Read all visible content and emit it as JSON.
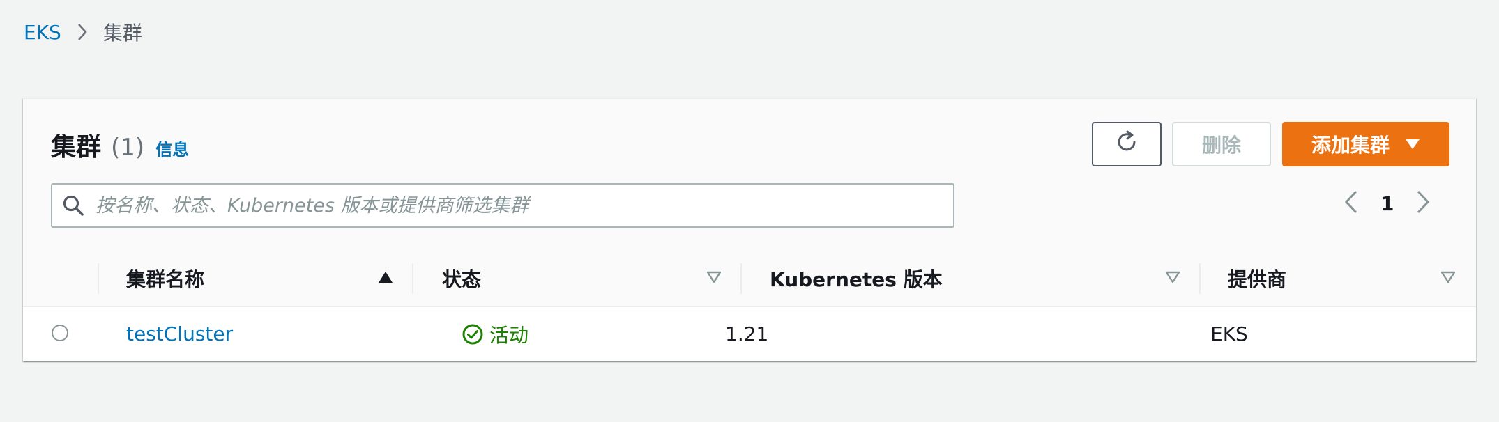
{
  "breadcrumb": {
    "root": "EKS",
    "current": "集群"
  },
  "header": {
    "title": "集群",
    "count": "(1)",
    "info_link": "信息",
    "delete_label": "删除",
    "add_label": "添加集群"
  },
  "search": {
    "placeholder": "按名称、状态、Kubernetes 版本或提供商筛选集群",
    "value": ""
  },
  "pagination": {
    "current_page": "1"
  },
  "table": {
    "columns": [
      "集群名称",
      "状态",
      "Kubernetes 版本",
      "提供商"
    ],
    "rows": [
      {
        "name": "testCluster",
        "status": "活动",
        "version": "1.21",
        "provider": "EKS"
      }
    ]
  },
  "colors": {
    "primary": "#ec7211",
    "link": "#0073bb",
    "success": "#1d8102"
  },
  "icons": [
    "chevron-right-icon",
    "refresh-icon",
    "caret-down-icon",
    "search-icon",
    "chevron-left-icon",
    "sort-ascending-icon",
    "sort-icon",
    "check-circle-icon"
  ]
}
